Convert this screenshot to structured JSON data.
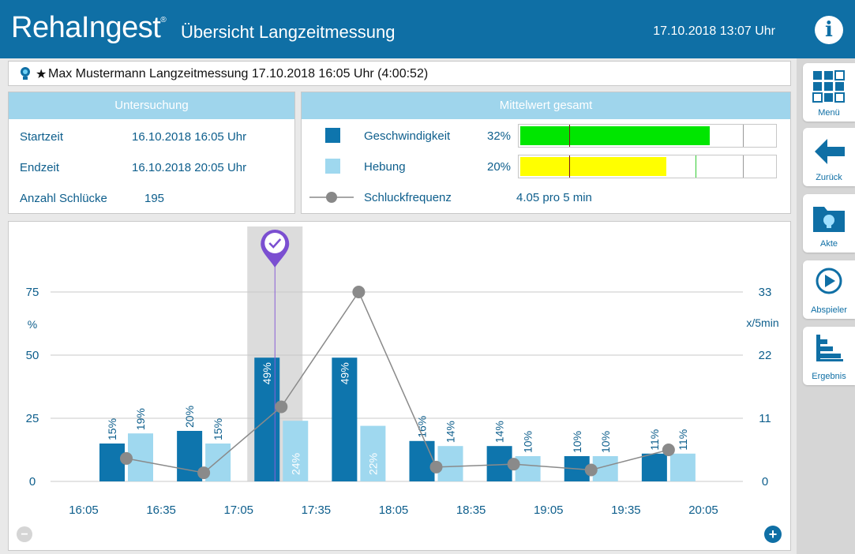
{
  "header": {
    "logo": "RehaIngest",
    "title": "Übersicht Langzeitmessung",
    "datetime": "17.10.2018  13:07 Uhr",
    "info_label": "i"
  },
  "patient": {
    "text": "Max Mustermann  Langzeitmessung 17.10.2018 16:05 Uhr (4:00:52)"
  },
  "exam": {
    "header": "Untersuchung",
    "rows": [
      {
        "label": "Startzeit",
        "value": "16.10.2018   16:05 Uhr"
      },
      {
        "label": "Endzeit",
        "value": "16.10.2018   20:05 Uhr"
      },
      {
        "label": "Anzahl Schlücke",
        "value": "195"
      }
    ]
  },
  "mean": {
    "header": "Mittelwert gesamt",
    "speed_label": "Geschwindigkeit",
    "speed_value": "32%",
    "speed_fill": 0.74,
    "lift_label": "Hebung",
    "lift_value": "20%",
    "lift_fill": 0.57,
    "freq_label": "Schluckfrequenz",
    "freq_value": "4.05 pro 5 min",
    "colors": {
      "speed": "#00e600",
      "lift": "#ffff00",
      "marker": "#8a1e1e"
    }
  },
  "sidebar": {
    "items": [
      {
        "label": "Menü",
        "icon": "grid-icon"
      },
      {
        "label": "Zurück",
        "icon": "arrow-left-icon"
      },
      {
        "label": "Akte",
        "icon": "folder-icon"
      },
      {
        "label": "Abspieler",
        "icon": "play-icon"
      },
      {
        "label": "Ergebnis",
        "icon": "bar-chart-icon"
      }
    ]
  },
  "chart_data": {
    "type": "bar",
    "x_ticks": [
      "16:05",
      "16:35",
      "17:05",
      "17:35",
      "18:05",
      "18:35",
      "19:05",
      "19:35",
      "20:05"
    ],
    "left_axis": {
      "label": "%",
      "ticks": [
        0,
        25,
        50,
        75
      ],
      "ylim": [
        0,
        75
      ]
    },
    "right_axis": {
      "label": "x/5min",
      "ticks": [
        0,
        11,
        22,
        33
      ],
      "ylim": [
        0,
        33
      ]
    },
    "categories": [
      "16:05-16:35",
      "16:35-17:05",
      "17:05-17:35",
      "17:35-18:05",
      "18:05-18:35",
      "18:35-19:05",
      "19:05-19:35",
      "19:35-20:05"
    ],
    "series": [
      {
        "name": "Geschwindigkeit",
        "type": "bar",
        "color": "#0e75ad",
        "values": [
          15,
          20,
          49,
          49,
          16,
          14,
          10,
          11
        ]
      },
      {
        "name": "Hebung",
        "type": "bar",
        "color": "#9fd8ef",
        "values": [
          19,
          15,
          24,
          22,
          14,
          10,
          10,
          11
        ]
      },
      {
        "name": "Schluckfrequenz",
        "type": "line",
        "color": "#8a8a8a",
        "values": [
          4,
          1.5,
          13,
          33,
          2.5,
          3,
          2,
          5.5
        ]
      }
    ],
    "selected_index": 2,
    "grid": true,
    "controls": {
      "zoom_out": "−",
      "zoom_in": "+"
    }
  }
}
